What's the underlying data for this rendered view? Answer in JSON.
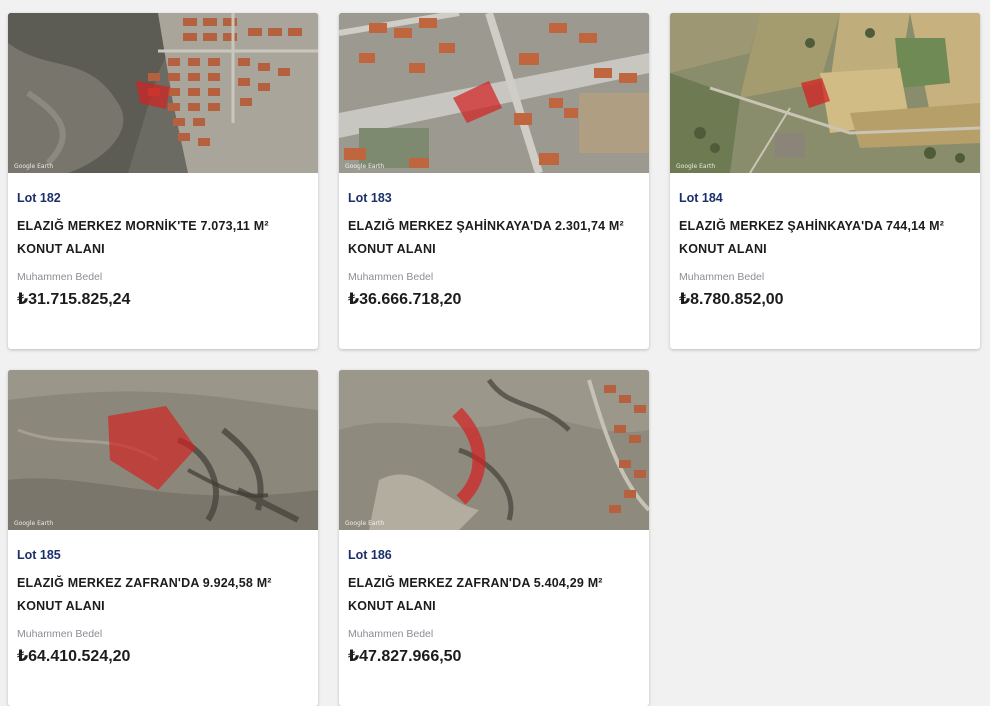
{
  "colors": {
    "lot_label": "#1b2f6b",
    "parcel_highlight": "#d32222",
    "card_bg": "#ffffff",
    "page_bg": "#f1f1f1"
  },
  "lots": [
    {
      "lot": "Lot 182",
      "title_line1": "ELAZIĞ MERKEZ MORNİK'TE 7.073,11 M²",
      "title_line2": "KONUT ALANI",
      "price_label": "Muhammen Bedel",
      "price": "₺31.715.825,24"
    },
    {
      "lot": "Lot 183",
      "title_line1": "ELAZIĞ MERKEZ ŞAHİNKAYA'DA 2.301,74 M²",
      "title_line2": "KONUT ALANI",
      "price_label": "Muhammen Bedel",
      "price": "₺36.666.718,20"
    },
    {
      "lot": "Lot 184",
      "title_line1": "ELAZIĞ MERKEZ ŞAHİNKAYA'DA 744,14 M²",
      "title_line2": "KONUT ALANI",
      "price_label": "Muhammen Bedel",
      "price": "₺8.780.852,00"
    },
    {
      "lot": "Lot 185",
      "title_line1": "ELAZIĞ MERKEZ ZAFRAN'DA 9.924,58 M²",
      "title_line2": "KONUT ALANI",
      "price_label": "Muhammen Bedel",
      "price": "₺64.410.524,20"
    },
    {
      "lot": "Lot 186",
      "title_line1": "ELAZIĞ MERKEZ ZAFRAN'DA 5.404,29 M²",
      "title_line2": "KONUT ALANI",
      "price_label": "Muhammen Bedel",
      "price": "₺47.827.966,50"
    }
  ]
}
